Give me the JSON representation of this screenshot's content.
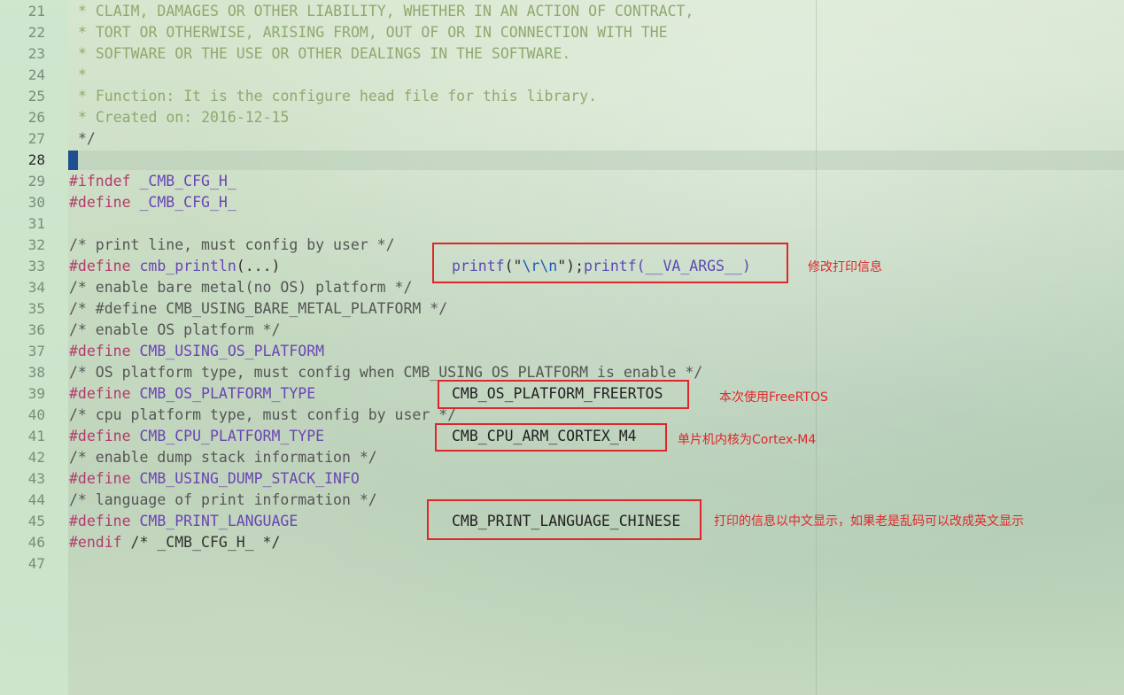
{
  "editor": {
    "current_line": "28",
    "lines": [
      {
        "n": "21",
        "text": "* CLAIM, DAMAGES OR OTHER LIABILITY, WHETHER IN AN ACTION OF CONTRACT,"
      },
      {
        "n": "22",
        "text": "* TORT OR OTHERWISE, ARISING FROM, OUT OF OR IN CONNECTION WITH THE"
      },
      {
        "n": "23",
        "text": "* SOFTWARE OR THE USE OR OTHER DEALINGS IN THE SOFTWARE."
      },
      {
        "n": "24",
        "text": "*"
      },
      {
        "n": "25",
        "text": "* Function: It is the configure head file for this library."
      },
      {
        "n": "26",
        "text": "* Created on: 2016-12-15"
      },
      {
        "n": "27",
        "text": "*/"
      },
      {
        "n": "28",
        "text": ""
      },
      {
        "n": "29",
        "kw": "#ifndef",
        "rest": " _CMB_CFG_H_"
      },
      {
        "n": "30",
        "kw": "#define",
        "rest": " _CMB_CFG_H_"
      },
      {
        "n": "31",
        "text": ""
      },
      {
        "n": "32",
        "text": "/* print line, must config by user */"
      },
      {
        "n": "33",
        "kw": "#define",
        "rest": " cmb_println",
        "tail": "(...)"
      },
      {
        "n": "34",
        "text": "/* enable bare metal(no OS) platform */"
      },
      {
        "n": "35",
        "text": "/* #define CMB_USING_BARE_METAL_PLATFORM */"
      },
      {
        "n": "36",
        "text": "/* enable OS platform */"
      },
      {
        "n": "37",
        "kw": "#define",
        "rest": " CMB_USING_OS_PLATFORM"
      },
      {
        "n": "38",
        "text": "/* OS platform type, must config when CMB_USING_OS_PLATFORM is enable */"
      },
      {
        "n": "39",
        "kw": "#define",
        "rest": " CMB_OS_PLATFORM_TYPE"
      },
      {
        "n": "40",
        "text": "/* cpu platform type, must config by user */"
      },
      {
        "n": "41",
        "kw": "#define",
        "rest": " CMB_CPU_PLATFORM_TYPE"
      },
      {
        "n": "42",
        "text": "/* enable dump stack information */"
      },
      {
        "n": "43",
        "kw": "#define",
        "rest": " CMB_USING_DUMP_STACK_INFO"
      },
      {
        "n": "44",
        "text": "/* language of print information */"
      },
      {
        "n": "45",
        "kw": "#define",
        "rest": " CMB_PRINT_LANGUAGE"
      },
      {
        "n": "46",
        "kw": "#endif",
        "rest": " /* _CMB_CFG_H_ */"
      },
      {
        "n": "47",
        "text": ""
      }
    ]
  },
  "annotations": {
    "println_value": {
      "fn1": "printf",
      "open1": "(\"",
      "esc": "\\r\\n",
      "close1": "\");",
      "fn2": "printf",
      "args": "(__VA_ARGS__)",
      "note": "修改打印信息"
    },
    "os_platform_value": {
      "value": "CMB_OS_PLATFORM_FREERTOS",
      "note": "本次使用FreeRTOS"
    },
    "cpu_platform_value": {
      "value": "CMB_CPU_ARM_CORTEX_M4",
      "note": "单片机内核为Cortex-M4"
    },
    "language_value": {
      "value": "CMB_PRINT_LANGUAGE_CHINESE",
      "note": "打印的信息以中文显示，如果老是乱码可以改成英文显示"
    }
  },
  "colors": {
    "highlight_box": "#e0262a",
    "keyword": "#b33a6c",
    "macro": "#6a45b4",
    "comment_header": "#8fa96f"
  }
}
